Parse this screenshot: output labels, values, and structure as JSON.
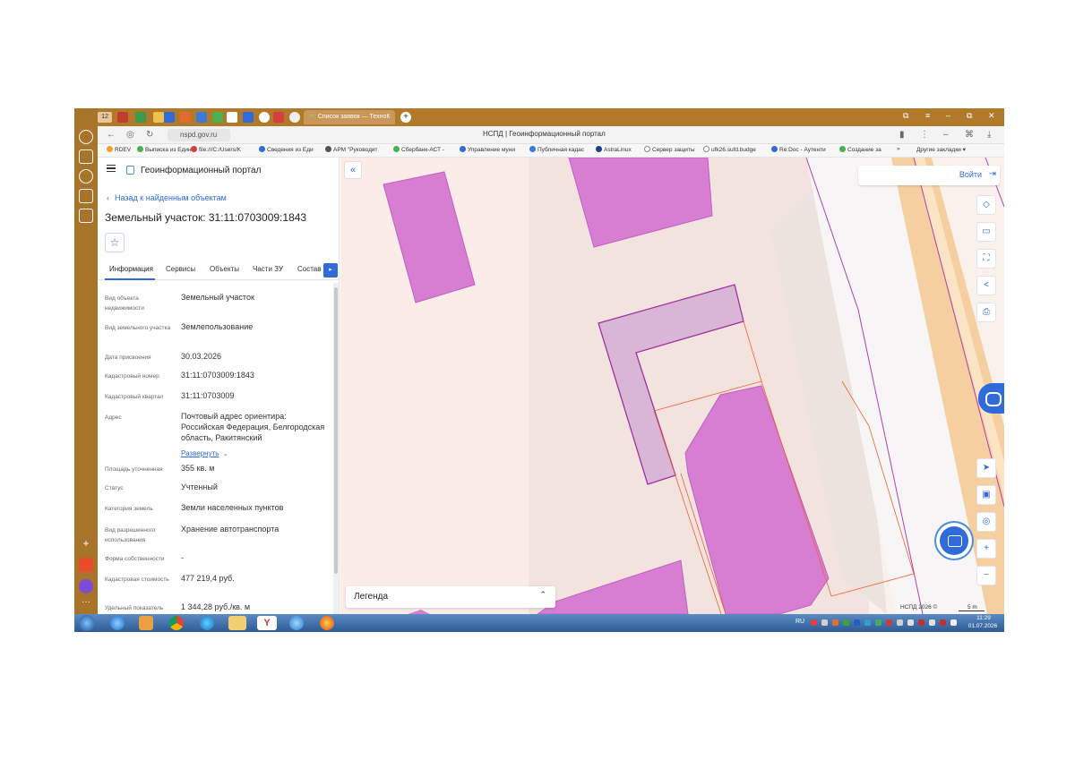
{
  "browser": {
    "tab_label": "Список заявок — ТехноК",
    "badge": "12",
    "url": "nspd.gov.ru",
    "page_title": "НСПД | Геоинформационный портал"
  },
  "bookmarks": [
    "RDEV",
    "Выписка из Един",
    "file:///C:/Users/K",
    "Сведения из Еди",
    "АРМ \"Руководит",
    "Сбербанк-АСТ - ",
    "Управление муни",
    "Публичная кадас",
    "AstraLinux",
    "Сервер защиты",
    "ufk26.sufd.budge",
    "Re:Doc - Аутенти",
    "Создание за",
    "Другие закладки"
  ],
  "panel": {
    "portal_title": "Геоинформационный портал",
    "back_link": "Назад к найденным объектам",
    "object_title": "Земельный участок: 31:11:0703009:1843",
    "tabs": [
      "Информация",
      "Сервисы",
      "Объекты",
      "Части ЗУ",
      "Состав"
    ],
    "properties": [
      {
        "label": "Вид объекта недвижимости",
        "value": "Земельный участок"
      },
      {
        "label": "Вид земельного участка",
        "value": "Землепользование"
      },
      {
        "label": "Дата присвоения",
        "value": "30.03.2026"
      },
      {
        "label": "Кадастровый номер",
        "value": "31:11:0703009:1843"
      },
      {
        "label": "Кадастровый квартал",
        "value": "31:11:0703009"
      },
      {
        "label": "Адрес",
        "value": "Почтовый адрес ориентира: Российская Федерация, Белгородская область, Ракитянский"
      },
      {
        "label": "Площадь уточненная",
        "value": "355 кв. м"
      },
      {
        "label": "Статус",
        "value": "Учтенный"
      },
      {
        "label": "Категория земель",
        "value": "Земли населенных пунктов"
      },
      {
        "label": "Вид разрешенного использования",
        "value": "Хранение автотранспорта"
      },
      {
        "label": "Форма собственности",
        "value": "-"
      },
      {
        "label": "Кадастровая стоимость",
        "value": "477 219,4 руб."
      },
      {
        "label": "Удельный показатель",
        "value": "1 344,28 руб./кв. м"
      }
    ],
    "expand_label": "Развернуть"
  },
  "map": {
    "login_label": "Войти",
    "legend_label": "Легенда",
    "copyright": "НСПД 2026 ©",
    "scale_label": "5 m",
    "colors": {
      "parcel": "#d77ed3",
      "selected": "#d9b5d6",
      "road": "#f5cfa0"
    }
  },
  "taskbar": {
    "lang": "RU",
    "time": "11:29",
    "date": "01.07.2026"
  }
}
